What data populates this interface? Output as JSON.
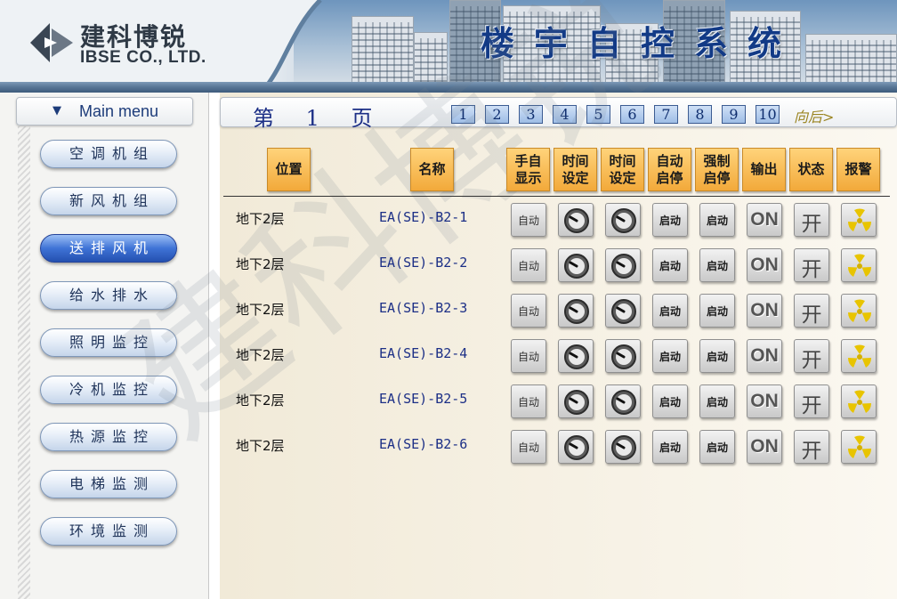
{
  "header": {
    "logo_cn": "建科博锐",
    "logo_en": "IBSE CO., LTD.",
    "system_title": "楼宇自控系统"
  },
  "sidebar": {
    "menu_title": "Main menu",
    "items": [
      {
        "label": "空调机组",
        "active": false
      },
      {
        "label": "新风机组",
        "active": false
      },
      {
        "label": "送排风机",
        "active": true
      },
      {
        "label": "给水排水",
        "active": false
      },
      {
        "label": "照明监控",
        "active": false
      },
      {
        "label": "冷机监控",
        "active": false
      },
      {
        "label": "热源监控",
        "active": false
      },
      {
        "label": "电梯监测",
        "active": false
      },
      {
        "label": "环境监测",
        "active": false
      }
    ]
  },
  "pager": {
    "current_label": "第 1 页",
    "pages": [
      "1",
      "2",
      "3",
      "4",
      "5",
      "6",
      "7",
      "8",
      "9",
      "10"
    ],
    "next_label": "向后>"
  },
  "watermark": "建科博锐",
  "table": {
    "columns": [
      "位置",
      "名称",
      "手自\n显示",
      "时间\n设定",
      "时间\n设定",
      "自动\n启停",
      "强制\n启停",
      "输出",
      "状态",
      "报警"
    ],
    "rows": [
      {
        "location": "地下2层",
        "name": "EA(SE)-B2-1",
        "mode": "自动",
        "auto_start": "启动",
        "force_start": "启动",
        "output": "ON",
        "status": "开"
      },
      {
        "location": "地下2层",
        "name": "EA(SE)-B2-2",
        "mode": "自动",
        "auto_start": "启动",
        "force_start": "启动",
        "output": "ON",
        "status": "开"
      },
      {
        "location": "地下2层",
        "name": "EA(SE)-B2-3",
        "mode": "自动",
        "auto_start": "启动",
        "force_start": "启动",
        "output": "ON",
        "status": "开"
      },
      {
        "location": "地下2层",
        "name": "EA(SE)-B2-4",
        "mode": "自动",
        "auto_start": "启动",
        "force_start": "启动",
        "output": "ON",
        "status": "开"
      },
      {
        "location": "地下2层",
        "name": "EA(SE)-B2-5",
        "mode": "自动",
        "auto_start": "启动",
        "force_start": "启动",
        "output": "ON",
        "status": "开"
      },
      {
        "location": "地下2层",
        "name": "EA(SE)-B2-6",
        "mode": "自动",
        "auto_start": "启动",
        "force_start": "启动",
        "output": "ON",
        "status": "开"
      }
    ]
  },
  "colors": {
    "title_blue": "#123a86",
    "header_orange": "#f2a93a",
    "active_menu_blue": "#3f73d6",
    "alarm_yellow": "#e8c400"
  },
  "icons": [
    "clock-icon",
    "radiation-alarm-icon",
    "chevron-down-icon"
  ]
}
